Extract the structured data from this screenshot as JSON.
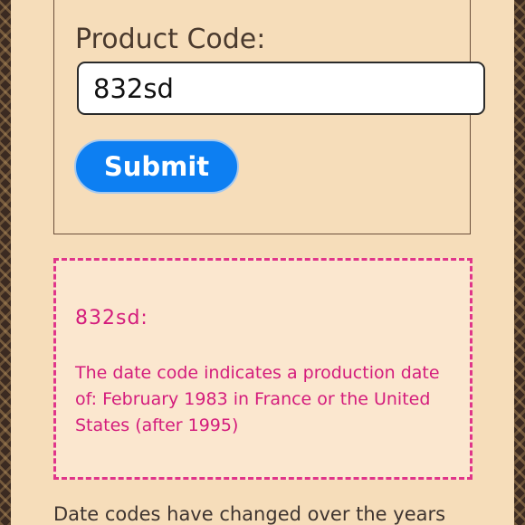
{
  "form": {
    "label": "Product Code:",
    "input_value": "832sd",
    "submit_label": "Submit"
  },
  "result": {
    "title": "832sd:",
    "text": "The date code indicates a production date of: February 1983 in France or the United States (after 1995)"
  },
  "footer": {
    "text": "Date codes have changed over the years"
  },
  "colors": {
    "background": "#f6ddba",
    "accent": "#0d7ff2",
    "result_text": "#d41c7c",
    "result_border": "#e0358a",
    "pattern_dark": "#3b2a21"
  }
}
